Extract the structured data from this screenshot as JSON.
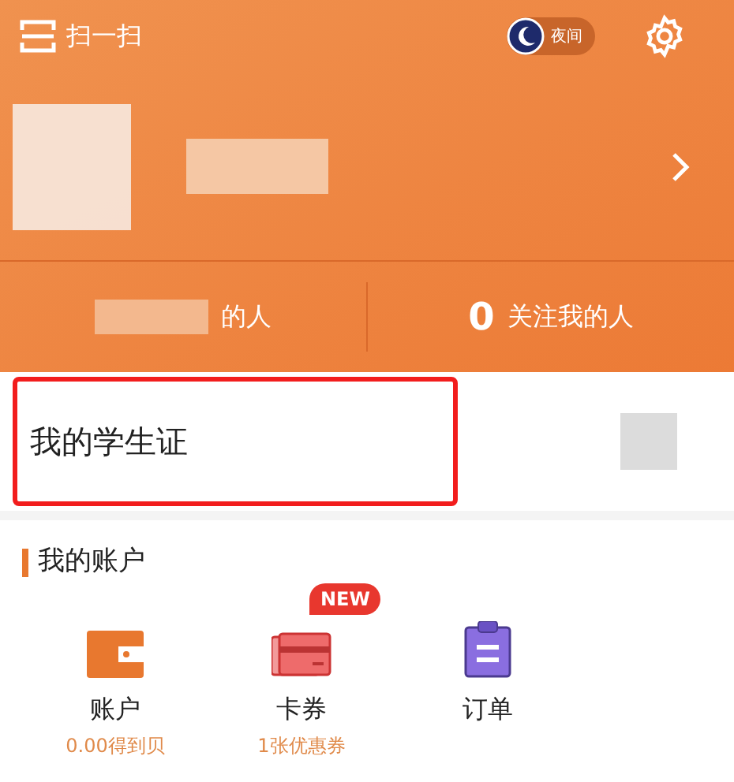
{
  "top_bar": {
    "scan_label": "扫一扫",
    "night_label": "夜间"
  },
  "stats": [
    {
      "label": "的人",
      "redacted": true
    },
    {
      "count": "0",
      "label": "关注我的人",
      "redacted": false
    }
  ],
  "student_card": {
    "title": "我的学生证",
    "highlighted": true
  },
  "account": {
    "title": "我的账户",
    "items": [
      {
        "kind": "wallet",
        "label": "账户",
        "sub": "0.00得到贝"
      },
      {
        "kind": "card",
        "label": "卡券",
        "sub": "1张优惠券",
        "badge": "NEW"
      },
      {
        "kind": "order",
        "label": "订单"
      }
    ]
  }
}
